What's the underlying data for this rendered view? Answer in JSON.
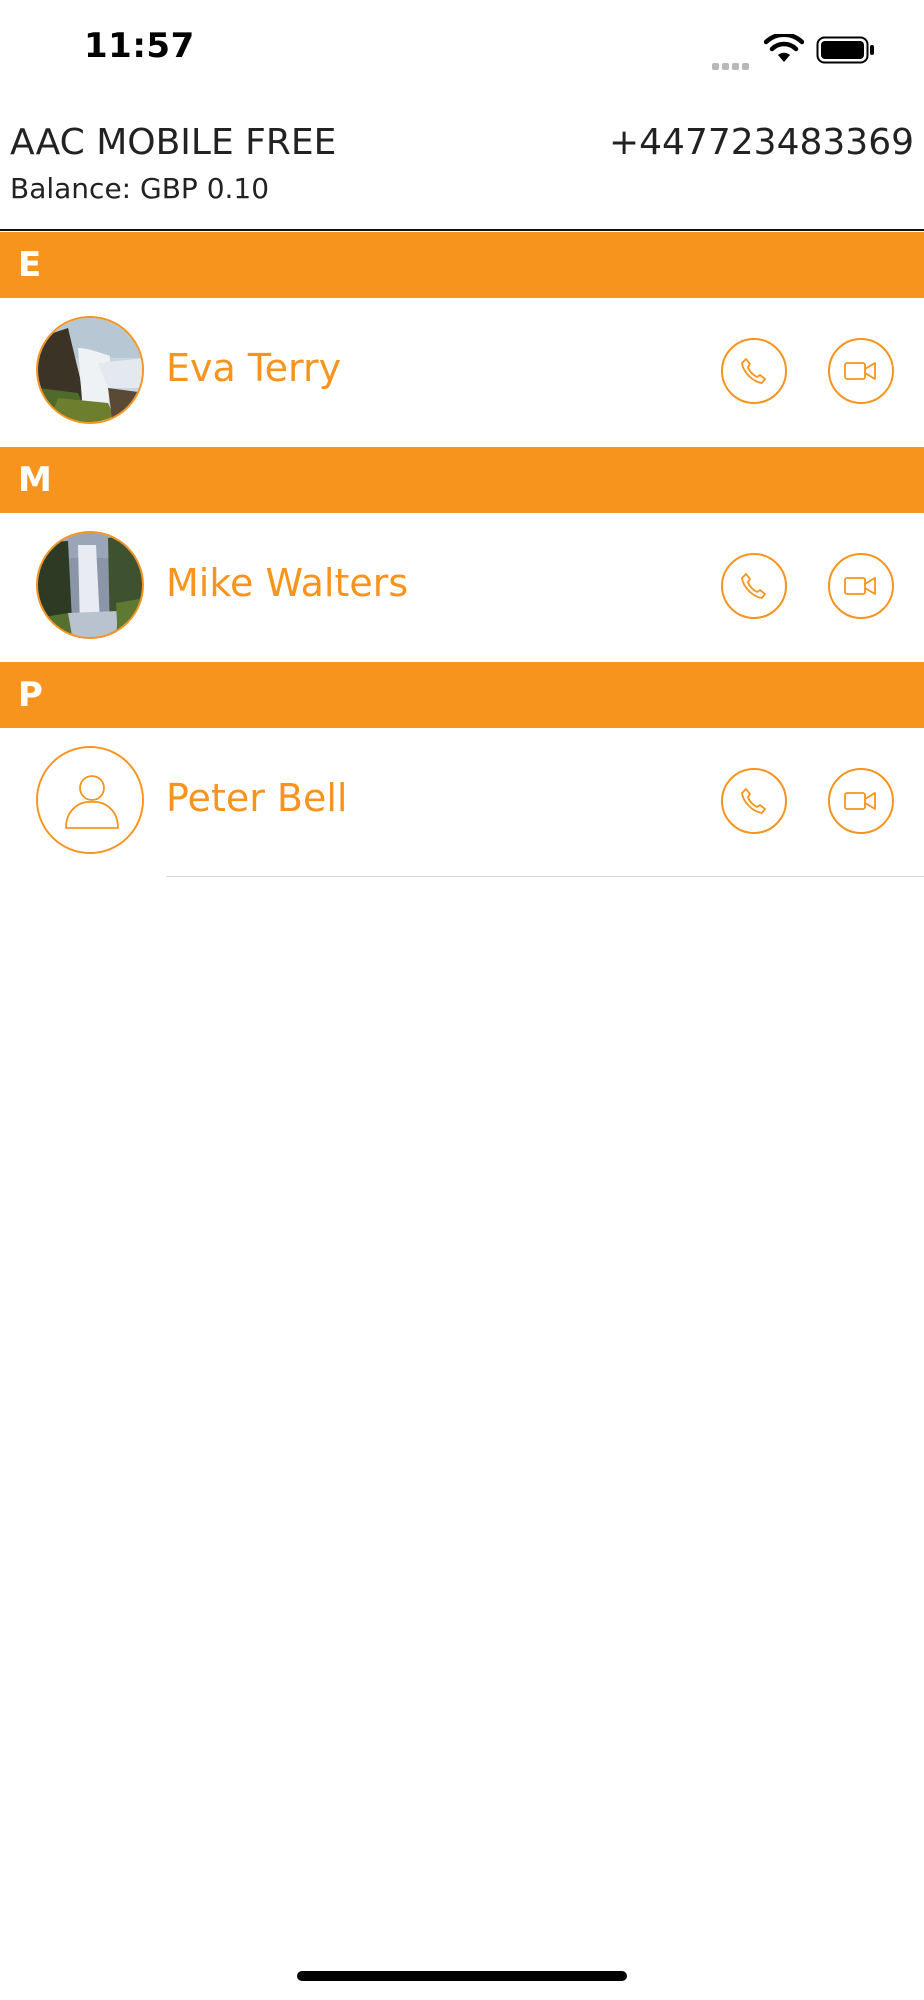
{
  "status_bar": {
    "time": "11:57"
  },
  "header": {
    "app_title": "AAC MOBILE FREE",
    "balance": "Balance: GBP 0.10",
    "phone_number": "+447723483369"
  },
  "colors": {
    "accent": "#F7941E",
    "text": "#222222"
  },
  "sections": [
    {
      "letter": "E",
      "contacts": [
        {
          "name": "Eva Terry",
          "avatar": "waterfall-photo-1"
        }
      ]
    },
    {
      "letter": "M",
      "contacts": [
        {
          "name": "Mike Walters",
          "avatar": "waterfall-photo-2"
        }
      ]
    },
    {
      "letter": "P",
      "contacts": [
        {
          "name": "Peter Bell",
          "avatar": "person-placeholder-icon"
        }
      ]
    }
  ]
}
